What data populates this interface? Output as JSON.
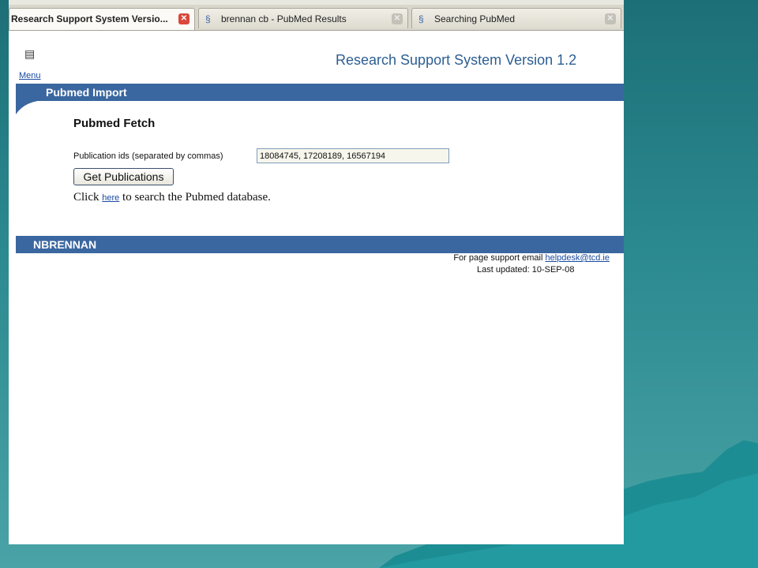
{
  "tabs": [
    {
      "title": "Research Support System Versio...",
      "active": true,
      "icon": "page-icon"
    },
    {
      "title": "brennan cb - PubMed Results",
      "active": false,
      "icon": "pubmed-icon"
    },
    {
      "title": "Searching PubMed",
      "active": false,
      "icon": "pubmed-icon"
    }
  ],
  "header": {
    "menu_label": "Menu",
    "menu_icon": "menu-icon",
    "app_title": "Research Support System Version 1.2"
  },
  "import_band": {
    "label": "Pubmed Import"
  },
  "fetch": {
    "title": "Pubmed Fetch",
    "ids_label": "Publication ids (separated by commas)",
    "ids_value": "18084745, 17208189, 16567194",
    "button_label": "Get Publications",
    "click_prefix": "Click",
    "here_link": "here",
    "click_suffix": "to search the Pubmed database."
  },
  "user_band": {
    "label": "NBRENNAN"
  },
  "footer": {
    "support_prefix": "For page support email",
    "support_email": "helpdesk@tcd.ie",
    "last_updated": "Last updated: 10-SEP-08"
  },
  "colors": {
    "band": "#3a67a0",
    "heading": "#2c5e93",
    "link": "#1a4aa0",
    "desktop": "#2b8a90"
  }
}
